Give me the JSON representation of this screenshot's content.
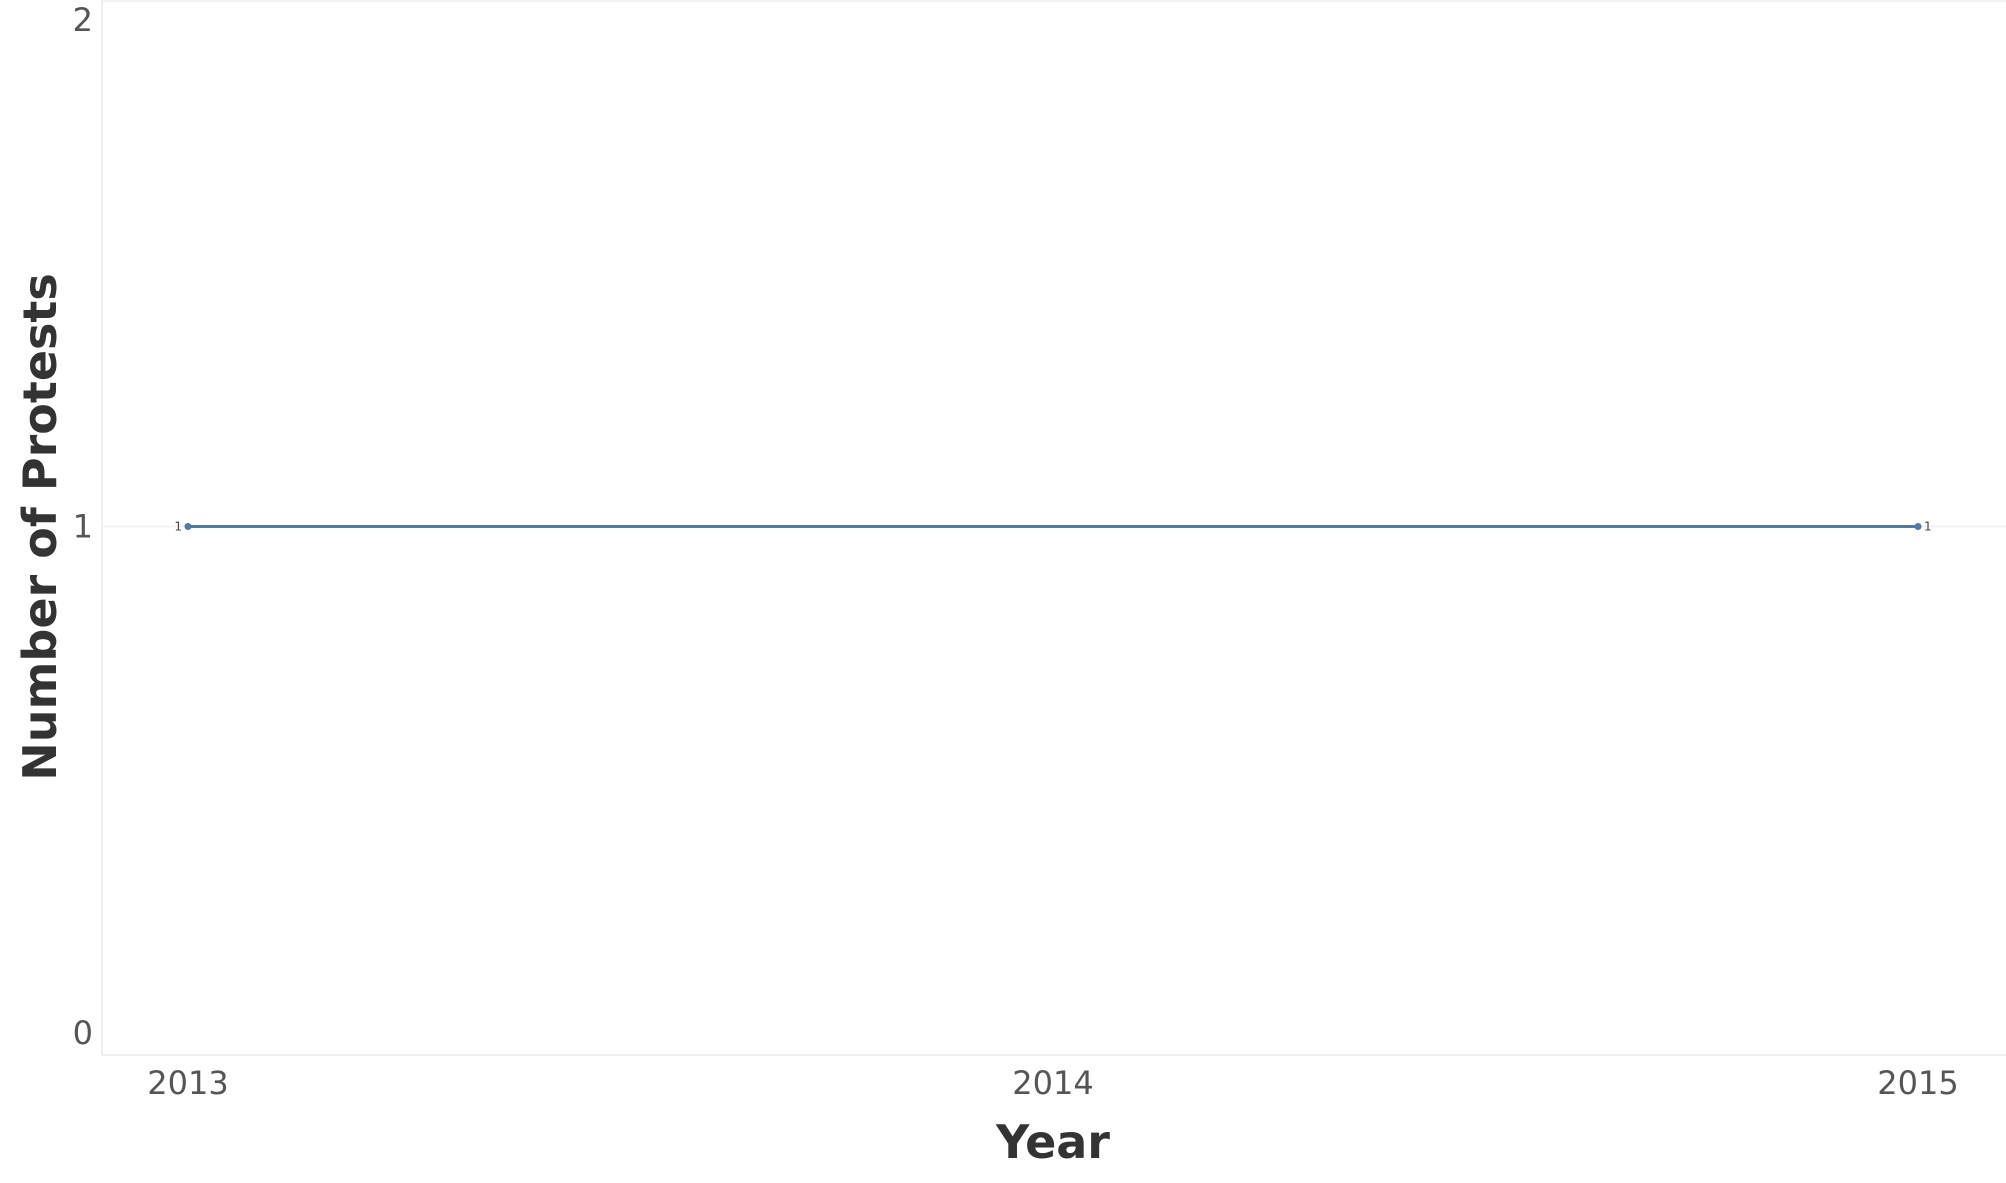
{
  "chart_data": {
    "type": "line",
    "title": "",
    "xlabel": "Year",
    "ylabel": "Number of Protests",
    "x": [
      "2013",
      "2015"
    ],
    "x_ticks": [
      "2013",
      "2014",
      "2015"
    ],
    "y_ticks": [
      "0",
      "1",
      "2"
    ],
    "ylim": [
      0,
      2
    ],
    "grid": false,
    "series": [
      {
        "values": [
          1,
          1
        ],
        "labels": [
          "1",
          "1"
        ],
        "color": "#4e79a7"
      }
    ]
  }
}
